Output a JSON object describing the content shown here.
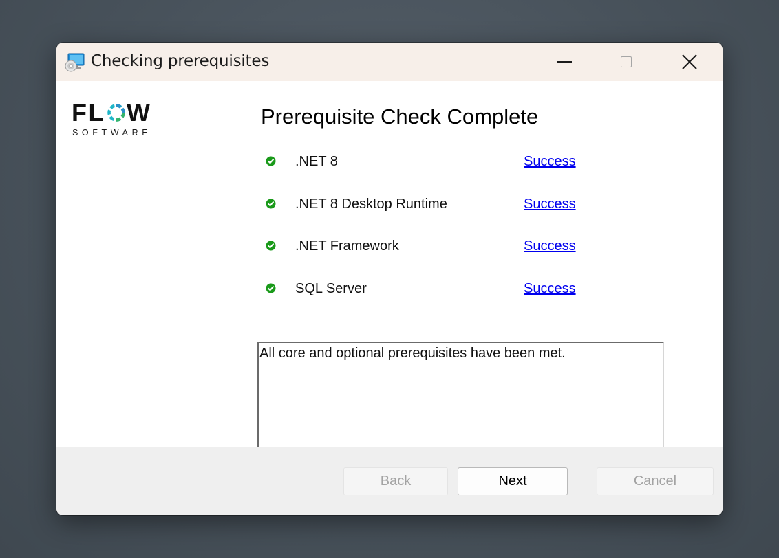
{
  "window": {
    "title": "Checking prerequisites",
    "icon": "installer-disc-icon",
    "controls": {
      "minimize": "minimize-icon",
      "maximize": "maximize-icon",
      "close": "close-icon"
    }
  },
  "logo": {
    "word_start": "FL",
    "word_end": "W",
    "tagline": "SOFTWARE",
    "ring_colors": [
      "#1fb6c8",
      "#2a90c8",
      "#36b46a"
    ]
  },
  "main": {
    "heading": "Prerequisite Check Complete",
    "prerequisites": [
      {
        "name": ".NET 8",
        "status": "Success",
        "icon": "check-circle-icon"
      },
      {
        "name": ".NET 8 Desktop Runtime",
        "status": "Success",
        "icon": "check-circle-icon"
      },
      {
        "name": ".NET Framework",
        "status": "Success",
        "icon": "check-circle-icon"
      },
      {
        "name": "SQL Server",
        "status": "Success",
        "icon": "check-circle-icon"
      }
    ],
    "message": "All core and optional prerequisites have been met."
  },
  "footer": {
    "back_label": "Back",
    "next_label": "Next",
    "cancel_label": "Cancel"
  },
  "colors": {
    "titlebar_bg": "#f7efe9",
    "success_green": "#1a9a1a",
    "link_blue": "#0000ee",
    "footer_bg": "#efefef",
    "disabled_text": "#a3a3a3"
  }
}
